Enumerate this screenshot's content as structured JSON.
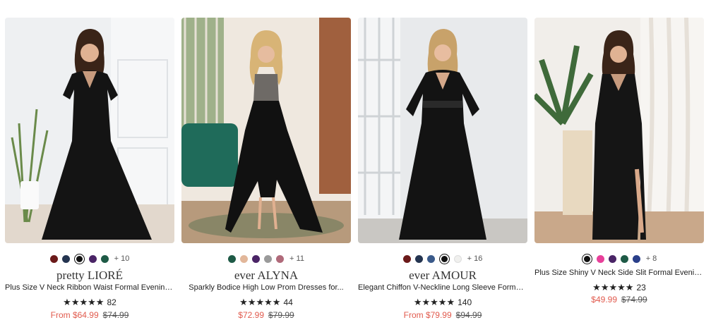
{
  "products": [
    {
      "brand": "pretty LIORÉ",
      "title": "Plus Size V Neck Ribbon Waist Formal Evening...",
      "swatches": [
        "#6b1a1a",
        "#243450",
        "#111111",
        "#4a2466",
        "#1e5a46"
      ],
      "selected_swatch": 2,
      "more_colors": "+ 10",
      "rating_stars": "★★★★★",
      "rating_value": 5,
      "review_count": "82",
      "price": "From $64.99",
      "original_price": "$74.99",
      "image_alt_icon": "dress-photo"
    },
    {
      "brand": "ever ALYNA",
      "title": "Sparkly Bodice High Low Prom Dresses for...",
      "swatches": [
        "#1e5a46",
        "#e2b79a",
        "#4a2466",
        "#9a9a9a",
        "#b06a7a"
      ],
      "selected_swatch": -1,
      "more_colors": "+ 11",
      "rating_stars": "★★★★★",
      "rating_value": 5,
      "review_count": "44",
      "price": "$72.99",
      "original_price": "$79.99",
      "image_alt_icon": "dress-photo"
    },
    {
      "brand": "ever AMOUR",
      "title": "Elegant Chiffon V-Neckline Long Sleeve Formal...",
      "swatches": [
        "#6b1a1a",
        "#243450",
        "#3a5a8a",
        "#111111",
        "#f0f0ee"
      ],
      "selected_swatch": 3,
      "more_colors": "+ 16",
      "rating_stars": "★★★★★",
      "rating_value": 5,
      "review_count": "140",
      "price": "From $79.99",
      "original_price": "$94.99",
      "image_alt_icon": "dress-photo"
    },
    {
      "brand": "",
      "title": "Plus Size Shiny V Neck Side Slit Formal Evening...",
      "swatches": [
        "#111111",
        "#e8409a",
        "#4a2466",
        "#1e5a46",
        "#2a3f8a"
      ],
      "selected_swatch": 0,
      "more_colors": "+ 8",
      "rating_stars": "★★★★★",
      "rating_value": 5,
      "review_count": "23",
      "price": "$49.99",
      "original_price": "$74.99",
      "image_alt_icon": "dress-photo"
    }
  ]
}
